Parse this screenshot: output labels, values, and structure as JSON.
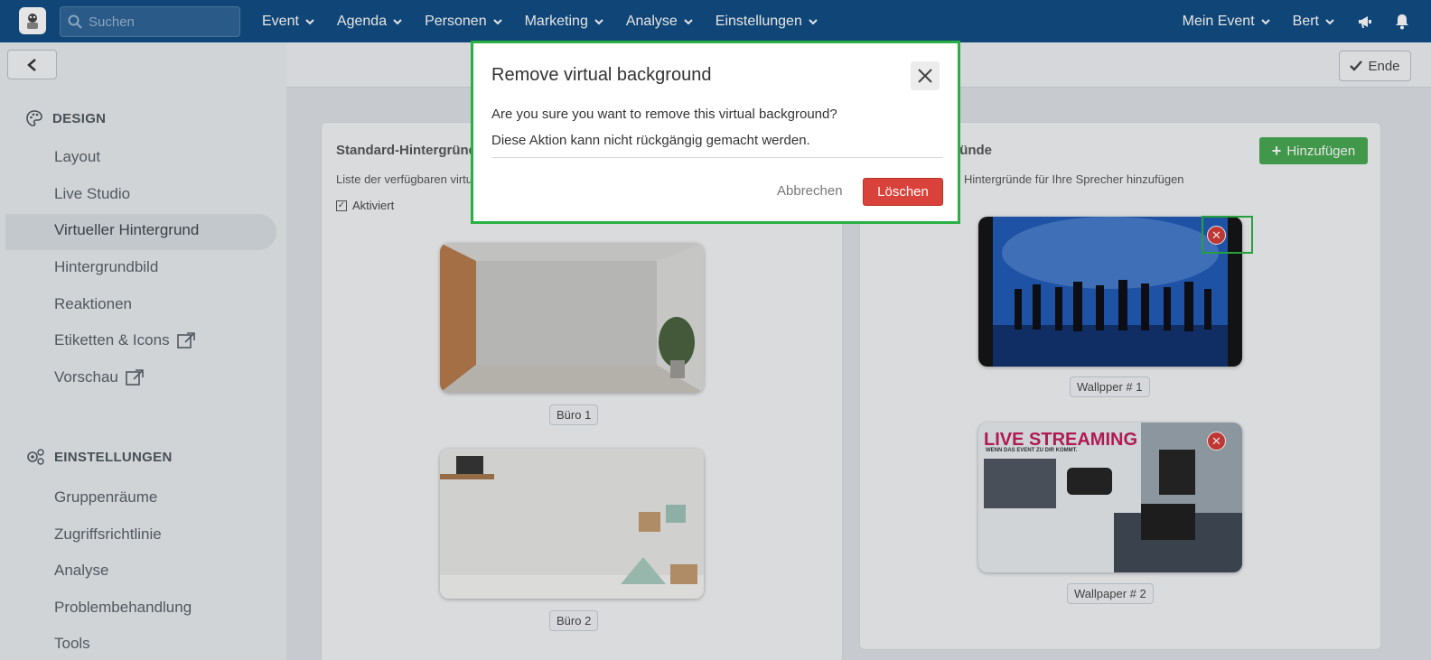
{
  "topbar": {
    "search_placeholder": "Suchen",
    "nav": [
      "Event",
      "Agenda",
      "Personen",
      "Marketing",
      "Analyse",
      "Einstellungen"
    ],
    "right": [
      "Mein Event",
      "Bert"
    ]
  },
  "sidebar": {
    "design_title": "DESIGN",
    "design_items": [
      "Layout",
      "Live Studio",
      "Virtueller Hintergrund",
      "Hintergrundbild",
      "Reaktionen",
      "Etiketten & Icons",
      "Vorschau"
    ],
    "settings_title": "EINSTELLUNGEN",
    "settings_items": [
      "Gruppenräume",
      "Zugriffsrichtlinie",
      "Analyse",
      "Problembehandlung",
      "Tools"
    ]
  },
  "main": {
    "ende_label": "Ende",
    "left_card": {
      "title": "Standard-Hintergründe",
      "subtitle": "Liste der verfügbaren virtu",
      "checkbox_label": "Aktiviert",
      "items": [
        "Büro 1",
        "Büro 2"
      ]
    },
    "right_card": {
      "title": "ierte Hintergründe",
      "subtitle": "Hintergründe für Ihre Sprecher hinzufügen",
      "add_label": "Hinzufügen",
      "items": [
        "Wallpper # 1",
        "Wallpaper # 2"
      ],
      "wallpaper2_overlay_title": "LIVE STREAMING",
      "wallpaper2_overlay_sub": "WENN DAS EVENT ZU DIR KOMMT."
    }
  },
  "modal": {
    "title": "Remove virtual background",
    "line1": "Are you sure you want to remove this virtual background?",
    "line2": "Diese Aktion kann nicht rückgängig gemacht werden.",
    "cancel_label": "Abbrechen",
    "delete_label": "Löschen"
  },
  "colors": {
    "topbar": "#0d4a82",
    "add_button": "#46a84f",
    "delete_button": "#d9423a",
    "highlight": "#28b043"
  }
}
